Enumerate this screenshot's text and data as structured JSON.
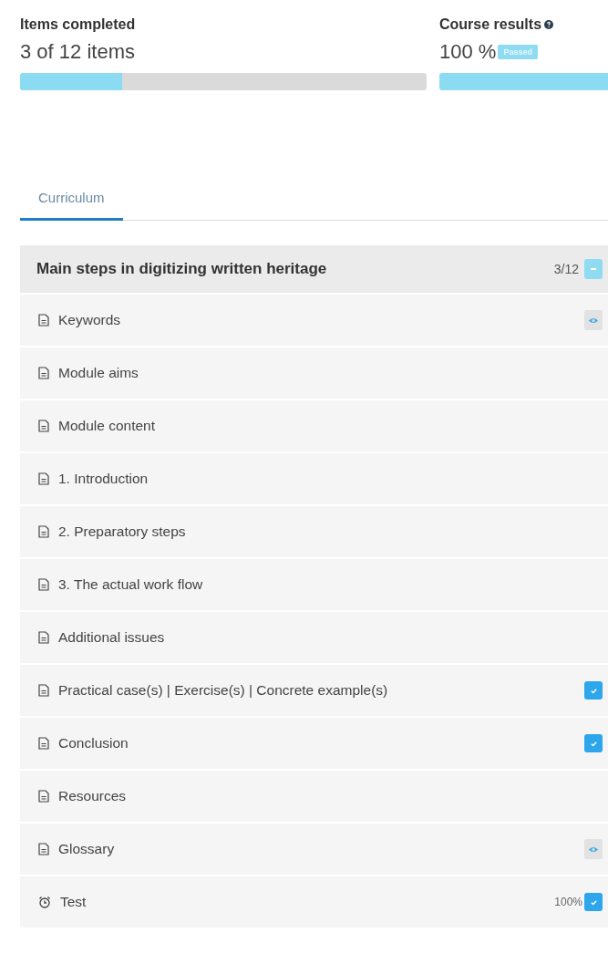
{
  "summary": {
    "items_completed": {
      "title": "Items completed",
      "value": "3 of 12 items",
      "level": 0.25
    },
    "course_results": {
      "title": "Course results",
      "value": "100 %",
      "badge": "Passed"
    }
  },
  "tabs": [
    {
      "label": "Curriculum",
      "selected": true
    }
  ],
  "module": {
    "title": "Main steps in digitizing written heritage",
    "count": "3/12",
    "expanded": true,
    "items": [
      {
        "kind": "page",
        "label": "Keywords",
        "completed": false,
        "viewed": true
      },
      {
        "kind": "page",
        "label": "Module aims",
        "completed": false,
        "viewed": false
      },
      {
        "kind": "page",
        "label": "Module content",
        "completed": false,
        "viewed": false
      },
      {
        "kind": "page",
        "label": "1. Introduction",
        "completed": false,
        "viewed": false
      },
      {
        "kind": "page",
        "label": "2. Preparatory steps",
        "completed": false,
        "viewed": false
      },
      {
        "kind": "page",
        "label": "3. The actual work flow",
        "completed": false,
        "viewed": false
      },
      {
        "kind": "page",
        "label": "Additional issues",
        "completed": false,
        "viewed": false
      },
      {
        "kind": "page",
        "label": "Practical case(s) | Exercise(s) | Concrete example(s)",
        "completed": true,
        "viewed": false
      },
      {
        "kind": "page",
        "label": "Conclusion",
        "completed": true,
        "viewed": false
      },
      {
        "kind": "page",
        "label": "Resources",
        "completed": false,
        "viewed": false
      },
      {
        "kind": "page",
        "label": "Glossary",
        "completed": false,
        "viewed": true
      },
      {
        "kind": "test",
        "label": "Test",
        "completed": true,
        "viewed": false,
        "score": "100%"
      }
    ]
  }
}
